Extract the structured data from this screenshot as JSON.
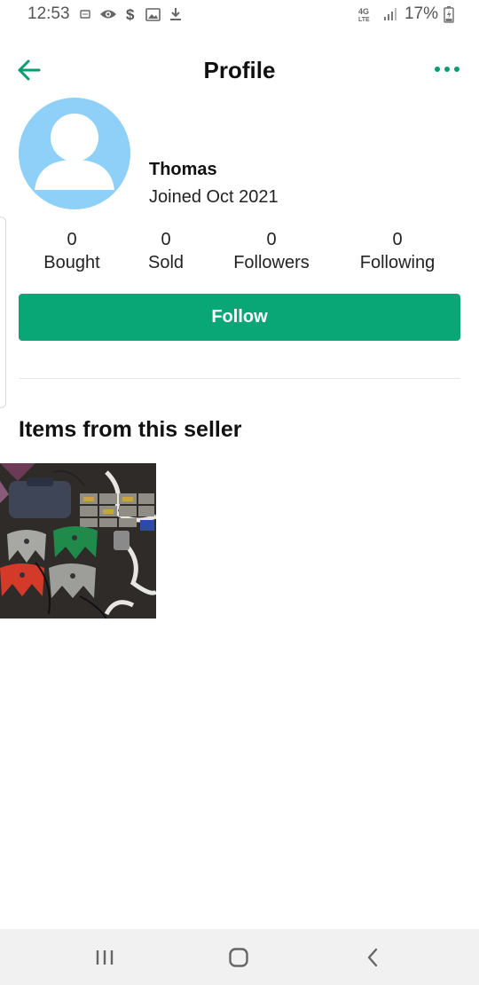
{
  "status_bar": {
    "time": "12:53",
    "battery_percent": "17%",
    "network": "4G LTE",
    "icons_left": [
      "message-icon",
      "eye-icon",
      "dollar-icon",
      "image-icon",
      "download-icon"
    ],
    "icons_right": [
      "4g-lte-icon",
      "signal-icon",
      "battery-charging-icon"
    ]
  },
  "header": {
    "title": "Profile",
    "back_icon": "arrow-left-icon",
    "more_icon": "more-options-icon",
    "accent_color": "#0a9c6f"
  },
  "profile": {
    "name": "Thomas",
    "joined": "Joined Oct 2021",
    "avatar_color": "#8ed0f7"
  },
  "stats": [
    {
      "value": "0",
      "label": "Bought"
    },
    {
      "value": "0",
      "label": "Sold"
    },
    {
      "value": "0",
      "label": "Followers"
    },
    {
      "value": "0",
      "label": "Following"
    }
  ],
  "follow_button": {
    "label": "Follow",
    "color": "#0aa776"
  },
  "items_section": {
    "title": "Items from this seller",
    "items": [
      {
        "image": "n64-console-controllers-photo"
      }
    ]
  },
  "nav_bar": {
    "buttons": [
      "recent-apps-icon",
      "home-icon",
      "back-nav-icon"
    ]
  }
}
